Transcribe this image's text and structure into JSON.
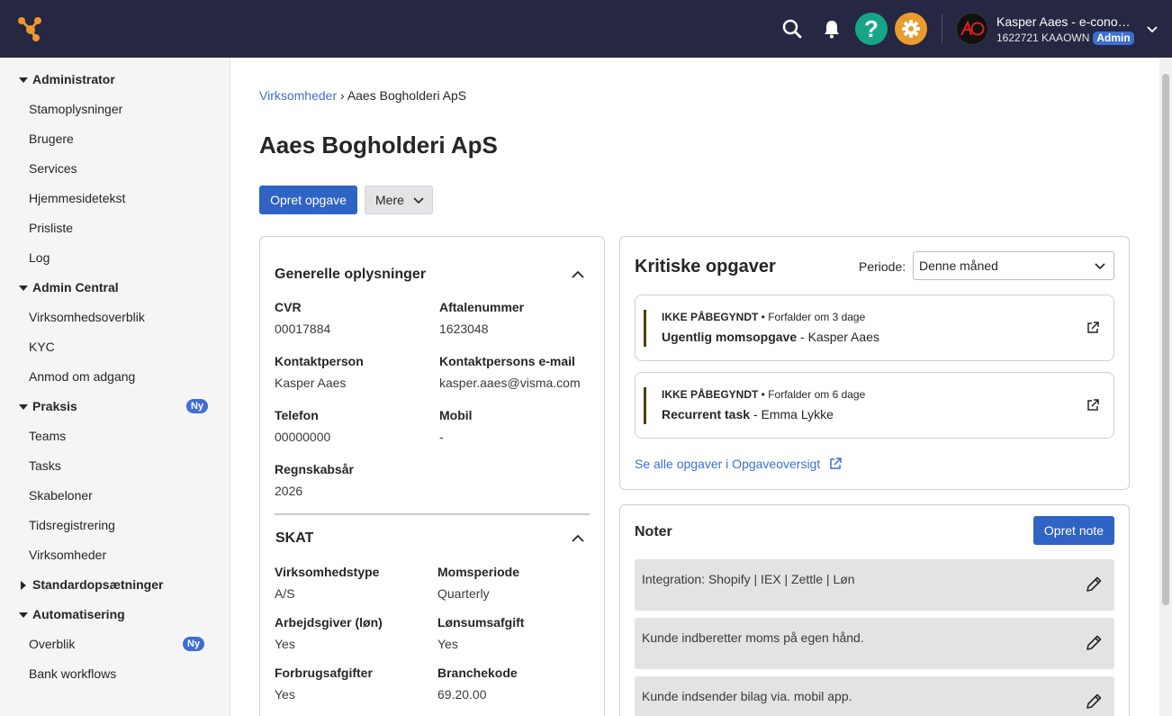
{
  "topbar": {
    "user_name": "Kasper Aaes - e-conomic",
    "user_sub": "1622721 KAAOWN",
    "role_badge": "Admin",
    "help_glyph": "?",
    "colors": {
      "bg": "#252743",
      "help": "#17a589",
      "settings": "#eb9b2d",
      "logo": "#f0962c"
    }
  },
  "sidebar": {
    "sections": [
      {
        "label": "Administrator",
        "expanded": true,
        "items": [
          "Stamoplysninger",
          "Brugere",
          "Services",
          "Hjemmesidetekst",
          "Prisliste",
          "Log"
        ]
      },
      {
        "label": "Admin Central",
        "expanded": true,
        "items": [
          "Virksomhedsoverblik",
          "KYC",
          "Anmod om adgang"
        ]
      },
      {
        "label": "Praksis",
        "expanded": true,
        "badge": "Ny",
        "items": [
          "Teams",
          "Tasks",
          "Skabeloner",
          "Tidsregistrering",
          "Virksomheder"
        ]
      },
      {
        "label": "Standardopsætninger",
        "expanded": false,
        "items": []
      },
      {
        "label": "Automatisering",
        "expanded": true,
        "items": [
          "Overblik",
          "Bank workflows"
        ],
        "item_badge": "Ny"
      }
    ]
  },
  "breadcrumb": {
    "parent": "Virksomheder",
    "separator": "›",
    "current": "Aaes Bogholderi ApS"
  },
  "page_title": "Aaes Bogholderi ApS",
  "actions": {
    "create_task": "Opret opgave",
    "more": "Mere"
  },
  "general": {
    "title": "Generelle oplysninger",
    "fields": [
      {
        "label": "CVR",
        "value": "00017884"
      },
      {
        "label": "Aftalenummer",
        "value": "1623048"
      },
      {
        "label": "Kontaktperson",
        "value": "Kasper Aaes"
      },
      {
        "label": "Kontaktpersons e-mail",
        "value": "kasper.aaes@visma.com"
      },
      {
        "label": "Telefon",
        "value": "00000000"
      },
      {
        "label": "Mobil",
        "value": "-"
      },
      {
        "label": "Regnskabsår",
        "value": "2026"
      }
    ]
  },
  "skat": {
    "title": "SKAT",
    "fields": [
      {
        "label": "Virksomhedstype",
        "value": "A/S"
      },
      {
        "label": "Momsperiode",
        "value": "Quarterly"
      },
      {
        "label": "Arbejdsgiver (løn)",
        "value": "Yes"
      },
      {
        "label": "Lønsumsafgift",
        "value": "Yes"
      },
      {
        "label": "Forbrugsafgifter",
        "value": "Yes"
      },
      {
        "label": "Branchekode",
        "value": "69.20.00"
      }
    ]
  },
  "critical": {
    "title": "Kritiske opgaver",
    "period_label": "Periode:",
    "period_value": "Denne måned",
    "tasks": [
      {
        "status": "IKKE PÅBEGYNDT",
        "due": " • Forfalder om 3 dage",
        "name": "Ugentlig momsopgave",
        "assignee": " - Kasper Aaes"
      },
      {
        "status": "IKKE PÅBEGYNDT",
        "due": " • Forfalder om 6 dage",
        "name": "Recurrent task",
        "assignee": " - Emma Lykke"
      }
    ],
    "see_all": "Se alle opgaver i Opgaveoversigt"
  },
  "notes": {
    "title": "Noter",
    "create": "Opret note",
    "items": [
      "Integration: Shopify | IEX | Zettle | Løn",
      "Kunde indberetter moms på egen hånd.",
      "Kunde indsender bilag via. mobil app."
    ]
  }
}
